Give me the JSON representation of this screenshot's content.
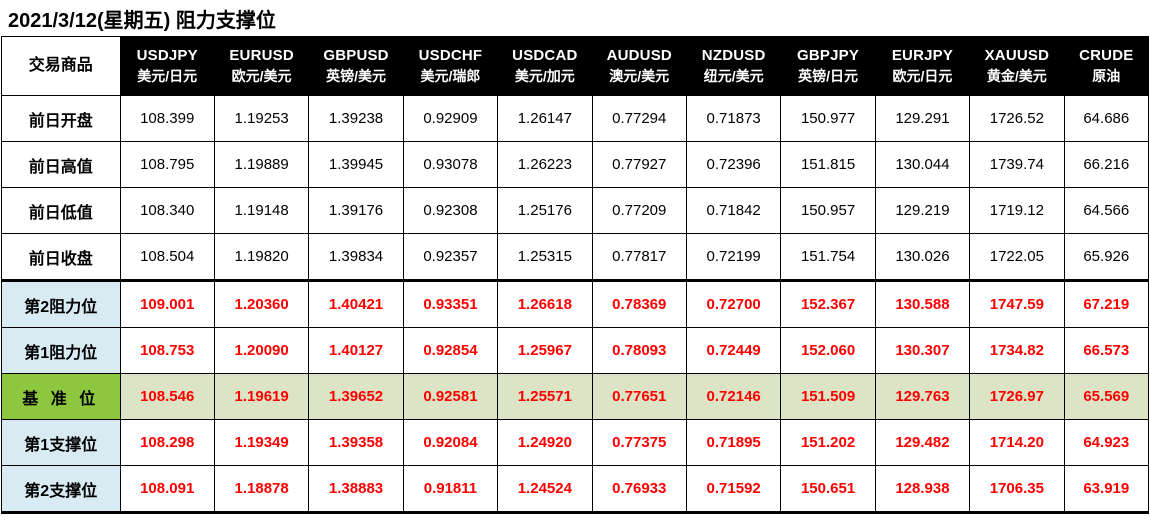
{
  "title": "2021/3/12(星期五)  阻力支撑位",
  "table": {
    "corner_label": "交易商品",
    "columns": [
      {
        "pair": "USDJPY",
        "cn": "美元/日元"
      },
      {
        "pair": "EURUSD",
        "cn": "欧元/美元"
      },
      {
        "pair": "GBPUSD",
        "cn": "英镑/美元"
      },
      {
        "pair": "USDCHF",
        "cn": "美元/瑞郎"
      },
      {
        "pair": "USDCAD",
        "cn": "美元/加元"
      },
      {
        "pair": "AUDUSD",
        "cn": "澳元/美元"
      },
      {
        "pair": "NZDUSD",
        "cn": "纽元/美元"
      },
      {
        "pair": "GBPJPY",
        "cn": "英镑/日元"
      },
      {
        "pair": "EURJPY",
        "cn": "欧元/日元"
      },
      {
        "pair": "XAUUSD",
        "cn": "黄金/美元"
      },
      {
        "pair": "CRUDE",
        "cn": "原油"
      }
    ],
    "rows": [
      {
        "label": "前日开盘",
        "style": "plain",
        "values": [
          "108.399",
          "1.19253",
          "1.39238",
          "0.92909",
          "1.26147",
          "0.77294",
          "0.71873",
          "150.977",
          "129.291",
          "1726.52",
          "64.686"
        ]
      },
      {
        "label": "前日高值",
        "style": "plain",
        "values": [
          "108.795",
          "1.19889",
          "1.39945",
          "0.93078",
          "1.26223",
          "0.77927",
          "0.72396",
          "151.815",
          "130.044",
          "1739.74",
          "66.216"
        ]
      },
      {
        "label": "前日低值",
        "style": "plain",
        "values": [
          "108.340",
          "1.19148",
          "1.39176",
          "0.92308",
          "1.25176",
          "0.77209",
          "0.71842",
          "150.957",
          "129.219",
          "1719.12",
          "64.566"
        ]
      },
      {
        "label": "前日收盘",
        "style": "plain-last",
        "values": [
          "108.504",
          "1.19820",
          "1.39834",
          "0.92357",
          "1.25315",
          "0.77817",
          "0.72199",
          "151.754",
          "130.026",
          "1722.05",
          "65.926"
        ]
      },
      {
        "label": "第2阻力位",
        "style": "pivot",
        "values": [
          "109.001",
          "1.20360",
          "1.40421",
          "0.93351",
          "1.26618",
          "0.78369",
          "0.72700",
          "152.367",
          "130.588",
          "1747.59",
          "67.219"
        ]
      },
      {
        "label": "第1阻力位",
        "style": "pivot",
        "values": [
          "108.753",
          "1.20090",
          "1.40127",
          "0.92854",
          "1.25967",
          "0.78093",
          "0.72449",
          "152.060",
          "130.307",
          "1734.82",
          "66.573"
        ]
      },
      {
        "label": "基 准 位",
        "style": "base",
        "values": [
          "108.546",
          "1.19619",
          "1.39652",
          "0.92581",
          "1.25571",
          "0.77651",
          "0.72146",
          "151.509",
          "129.763",
          "1726.97",
          "65.569"
        ]
      },
      {
        "label": "第1支撑位",
        "style": "pivot",
        "values": [
          "108.298",
          "1.19349",
          "1.39358",
          "0.92084",
          "1.24920",
          "0.77375",
          "0.71895",
          "151.202",
          "129.482",
          "1714.20",
          "64.923"
        ]
      },
      {
        "label": "第2支撑位",
        "style": "pivot-last",
        "values": [
          "108.091",
          "1.18878",
          "1.38883",
          "0.91811",
          "1.24524",
          "0.76933",
          "0.71592",
          "150.651",
          "128.938",
          "1706.35",
          "63.919"
        ]
      }
    ]
  },
  "colors": {
    "header_bg": "#000000",
    "header_text": "#ffffff",
    "pivot_text": "#ff0000",
    "label_blue": "#d8eaf2",
    "baseline_label_green": "#8dc63f",
    "baseline_cell_green": "#dde4c5",
    "grid": "#000000"
  }
}
